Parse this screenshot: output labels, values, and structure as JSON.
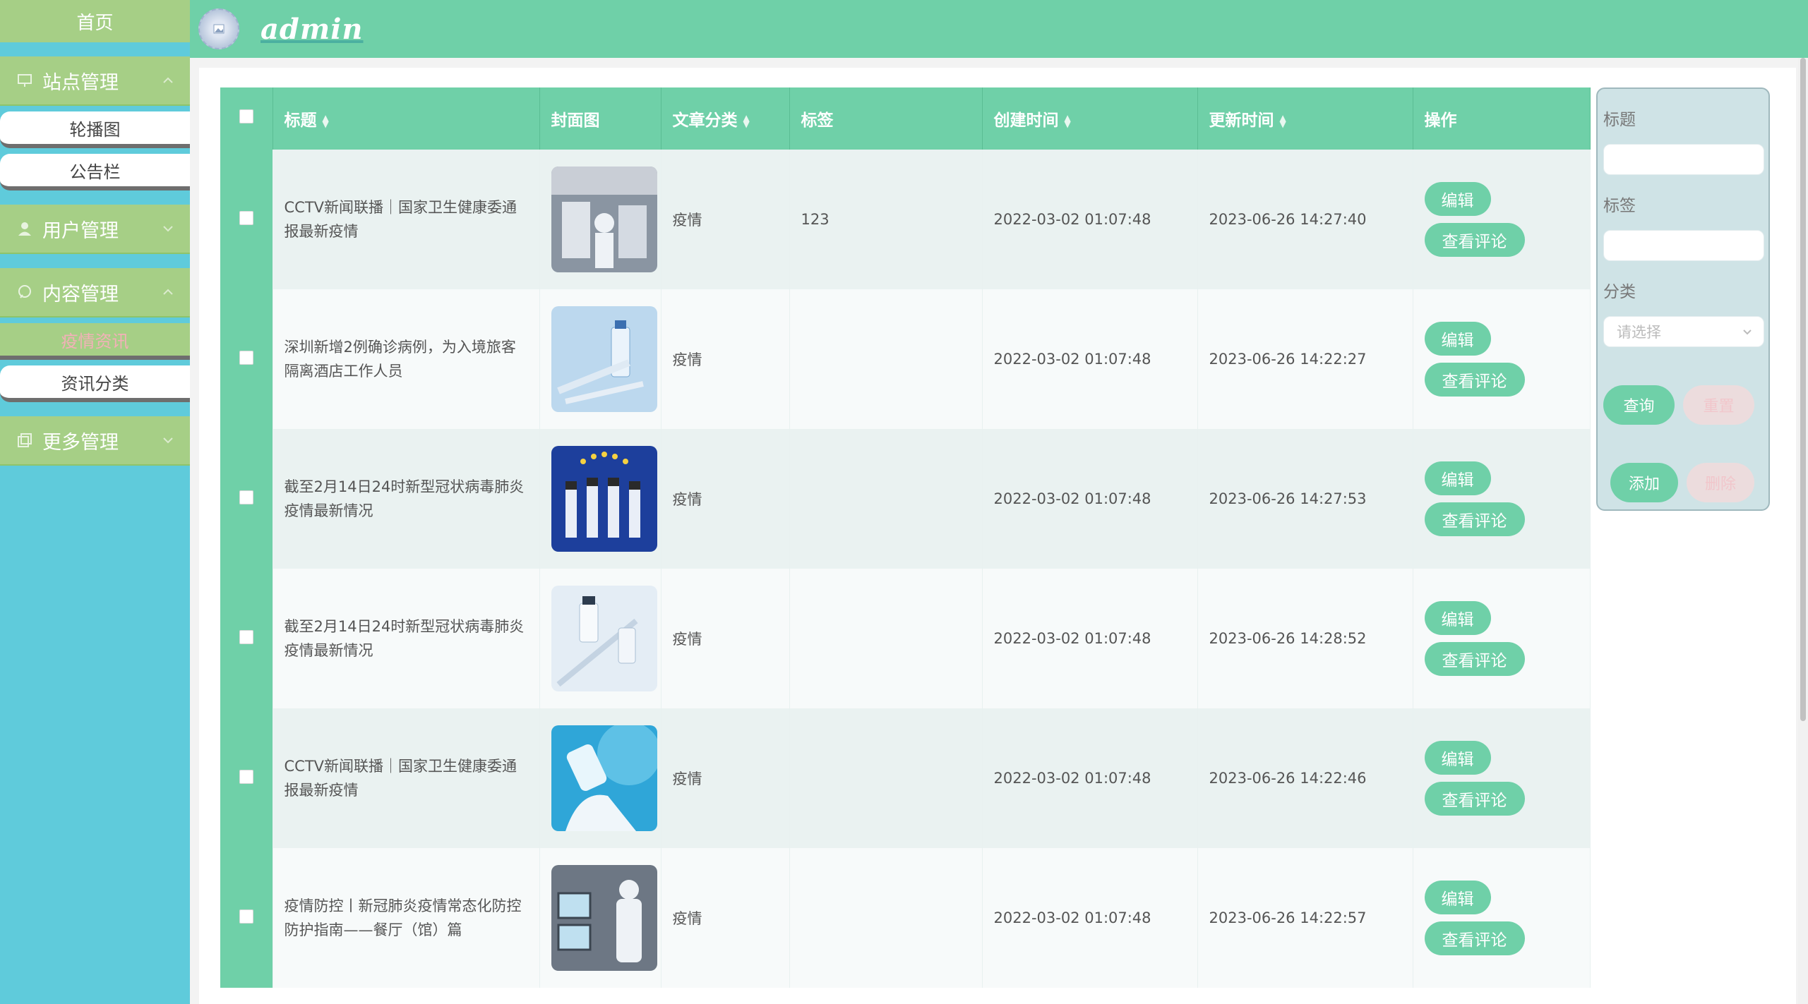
{
  "sidebar": {
    "home": "首页",
    "groups": [
      {
        "label": "站点管理",
        "icon": "monitor-icon",
        "expanded": true,
        "items": [
          "轮播图",
          "公告栏"
        ]
      },
      {
        "label": "用户管理",
        "icon": "user-icon",
        "expanded": false,
        "items": []
      },
      {
        "label": "内容管理",
        "icon": "chat-icon",
        "expanded": true,
        "items": [
          "疫情资讯",
          "资讯分类"
        ],
        "active_item": "疫情资讯"
      },
      {
        "label": "更多管理",
        "icon": "copy-icon",
        "expanded": false,
        "items": []
      }
    ]
  },
  "header": {
    "brand": "admin"
  },
  "table": {
    "columns": [
      "标题",
      "封面图",
      "文章分类",
      "标签",
      "创建时间",
      "更新时间",
      "操作"
    ],
    "sortable": [
      "标题",
      "文章分类",
      "创建时间",
      "更新时间"
    ],
    "rows": [
      {
        "title": "CCTV新闻联播｜国家卫生健康委通报最新疫情",
        "category": "疫情",
        "tag": "123",
        "created": "2022-03-02 01:07:48",
        "updated": "2023-06-26 14:27:40"
      },
      {
        "title": "深圳新增2例确诊病例，为入境旅客隔离酒店工作人员",
        "category": "疫情",
        "tag": "",
        "created": "2022-03-02 01:07:48",
        "updated": "2023-06-26 14:22:27"
      },
      {
        "title": "截至2月14日24时新型冠状病毒肺炎疫情最新情况",
        "category": "疫情",
        "tag": "",
        "created": "2022-03-02 01:07:48",
        "updated": "2023-06-26 14:27:53"
      },
      {
        "title": "截至2月14日24时新型冠状病毒肺炎疫情最新情况",
        "category": "疫情",
        "tag": "",
        "created": "2022-03-02 01:07:48",
        "updated": "2023-06-26 14:28:52"
      },
      {
        "title": "CCTV新闻联播｜国家卫生健康委通报最新疫情",
        "category": "疫情",
        "tag": "",
        "created": "2022-03-02 01:07:48",
        "updated": "2023-06-26 14:22:46"
      },
      {
        "title": "疫情防控丨新冠肺炎疫情常态化防控防护指南——餐厅（馆）篇",
        "category": "疫情",
        "tag": "",
        "created": "2022-03-02 01:07:48",
        "updated": "2023-06-26 14:22:57"
      }
    ],
    "actions": {
      "edit": "编辑",
      "comments": "查看评论"
    }
  },
  "search": {
    "title_label": "标题",
    "tag_label": "标签",
    "category_label": "分类",
    "category_placeholder": "请选择",
    "query_btn": "查询",
    "reset_btn": "重置",
    "add_btn": "添加",
    "delete_btn": "删除"
  },
  "colors": {
    "accent": "#6fd0a8",
    "sidebar_bg": "#5fcbdb",
    "sidebar_group": "#a6cf86",
    "active_text": "#f3b1b8"
  }
}
